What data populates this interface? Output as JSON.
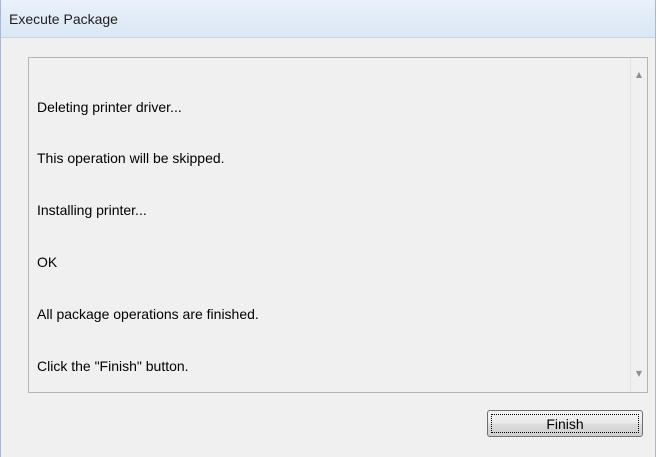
{
  "window": {
    "title": "Execute Package"
  },
  "log": {
    "lines": [
      "Deleting printer driver...",
      "This operation will be skipped.",
      "Installing printer...",
      "OK",
      "All package operations are finished.",
      "Click the \"Finish\" button."
    ]
  },
  "scrollbar": {
    "up_icon": "chevron-up",
    "down_icon": "chevron-down"
  },
  "actions": {
    "finish_label": "Finish"
  }
}
